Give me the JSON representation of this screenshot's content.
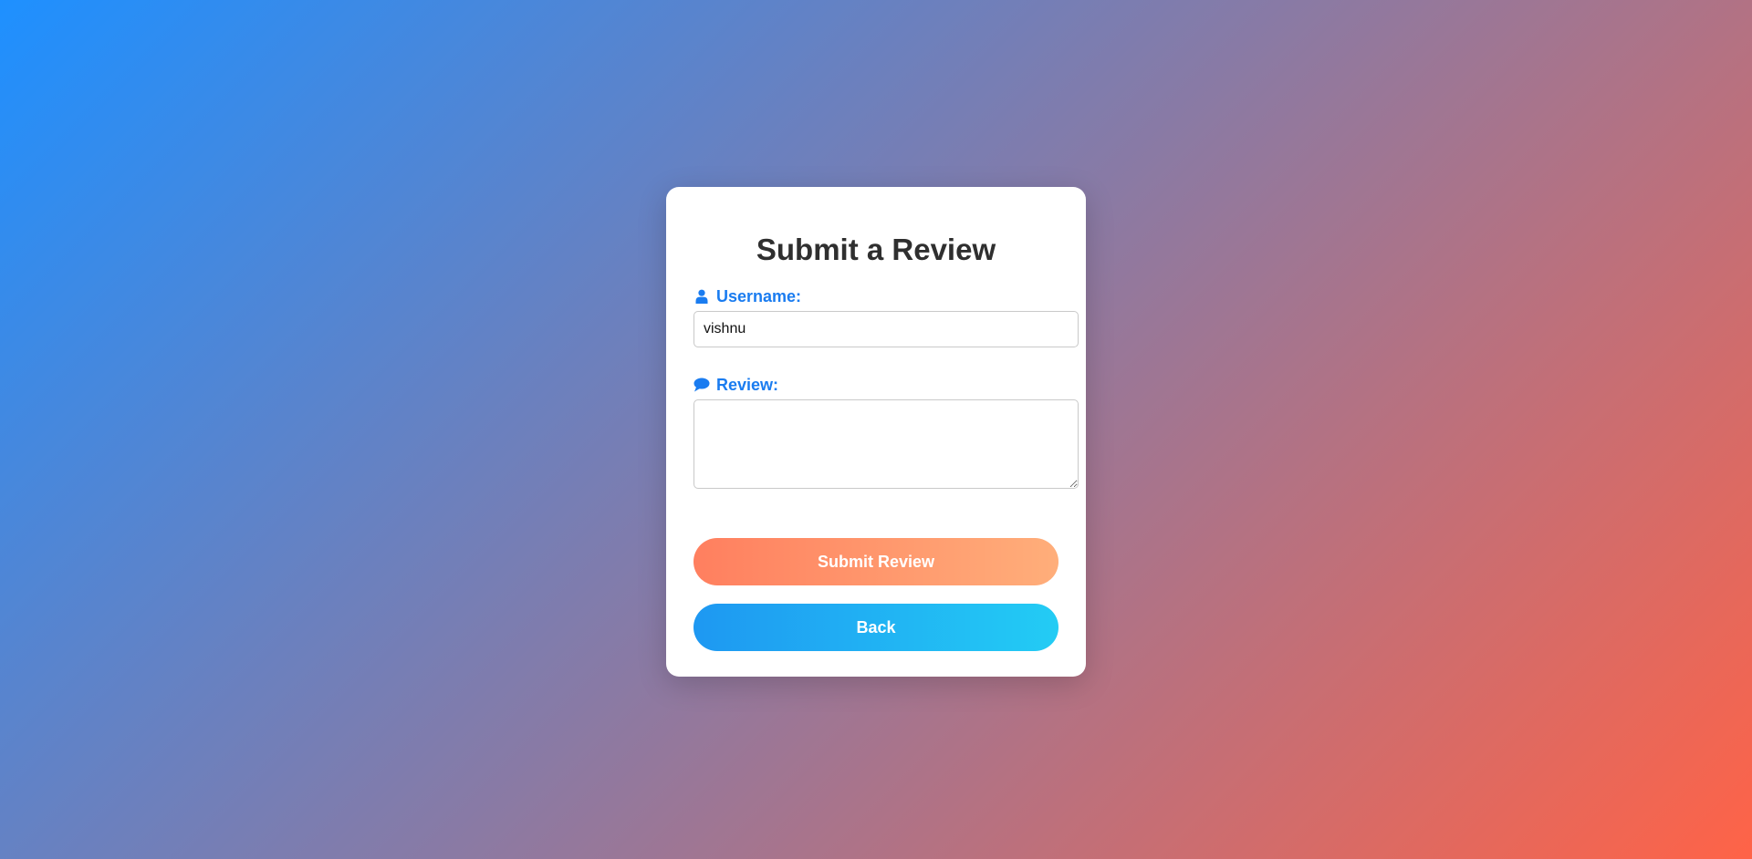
{
  "page": {
    "background_colors": [
      "#1e90ff",
      "#8a7aa4",
      "#ff6347"
    ]
  },
  "form": {
    "title": "Submit a Review",
    "username": {
      "icon": "user-icon",
      "label": "Username:",
      "value": "vishnu"
    },
    "review": {
      "icon": "comment-icon",
      "label": "Review:",
      "value": ""
    },
    "submit_label": "Submit Review",
    "back_label": "Back"
  },
  "colors": {
    "label": "#1a7cf0",
    "submit_gradient": [
      "#ff7f5f",
      "#ffae7a"
    ],
    "back_gradient": [
      "#1e98f2",
      "#23ccf4"
    ]
  }
}
